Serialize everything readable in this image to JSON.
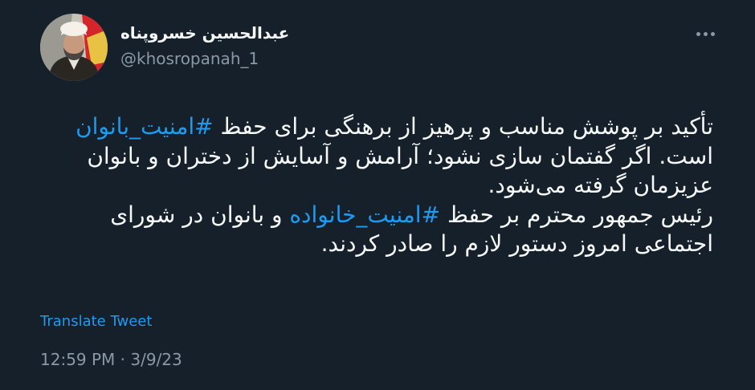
{
  "author": {
    "display_name": "عبدالحسین خسروپناه",
    "handle": "@khosropanah_1"
  },
  "tweet": {
    "line1_before": "تأکید بر پوشش مناسب و پرهیز از برهنگی برای حفظ ",
    "hashtag1": "#امنیت_بانوان",
    "line2": "است. اگر گفتمان سازی نشود؛ آرامش و آسایش از دختران و بانوان",
    "line3": "عزیزمان گرفته می‌شود.",
    "line4_before": "رئیس جمهور محترم بر حفظ ",
    "hashtag2": "#امنیت_خانواده",
    "line4_after": " و بانوان در شورای",
    "line5": "اجتماعی امروز دستور لازم را صادر کردند."
  },
  "translate_label": "Translate Tweet",
  "timestamp": "12:59 PM · 3/9/23",
  "icons": {
    "more": "more-horizontal-icon",
    "avatar": "profile-avatar"
  },
  "colors": {
    "background": "#15202b",
    "link": "#1d9bf0",
    "secondary_text": "#8b98a5",
    "primary_text": "#f7f9f9"
  }
}
